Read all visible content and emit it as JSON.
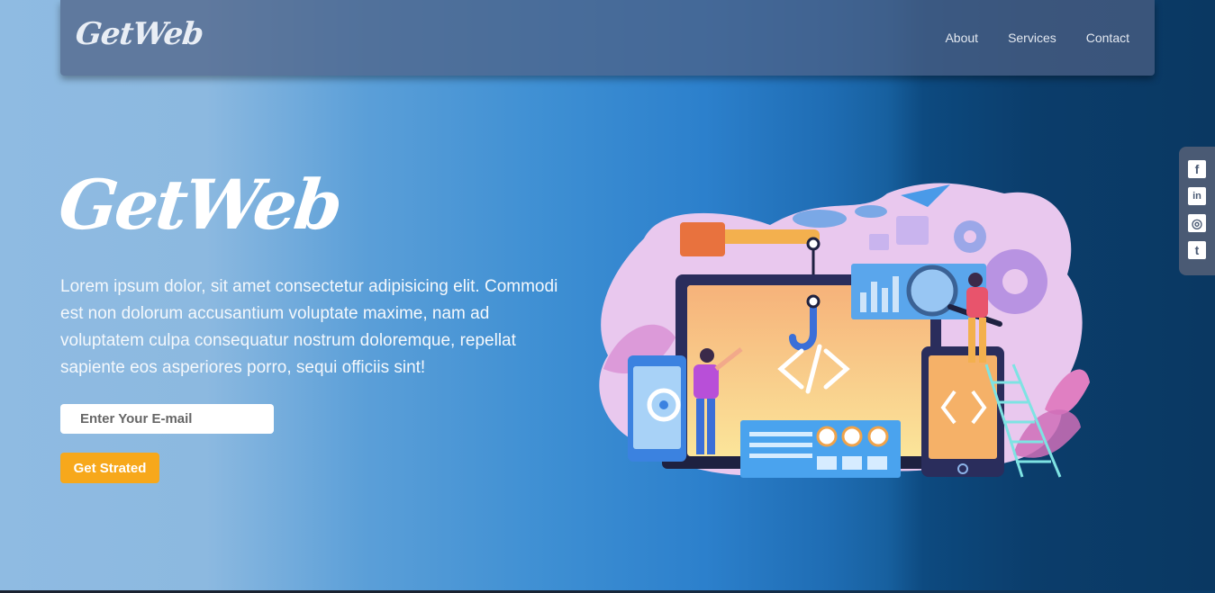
{
  "navbar": {
    "brand": "GetWeb",
    "links": [
      "About",
      "Services",
      "Contact"
    ]
  },
  "hero": {
    "title": "GetWeb",
    "text": "Lorem ipsum dolor, sit amet consectetur adipisicing elit. Commodi est non dolorum accusantium voluptate maxime, nam ad voluptatem culpa consequatur nostrum doloremque, repellat sapiente eos asperiores porro, sequi officiis sint!",
    "email_placeholder": "Enter Your E-mail",
    "cta_label": "Get Strated"
  },
  "social": {
    "icons": [
      "facebook-icon",
      "linkedin-icon",
      "instagram-icon",
      "twitter-icon"
    ],
    "glyphs": [
      "f",
      "in",
      "◎",
      "t"
    ]
  },
  "colors": {
    "accent": "#f7a81b",
    "navbar": "#4e6084",
    "social_bar": "#4a5a74"
  }
}
